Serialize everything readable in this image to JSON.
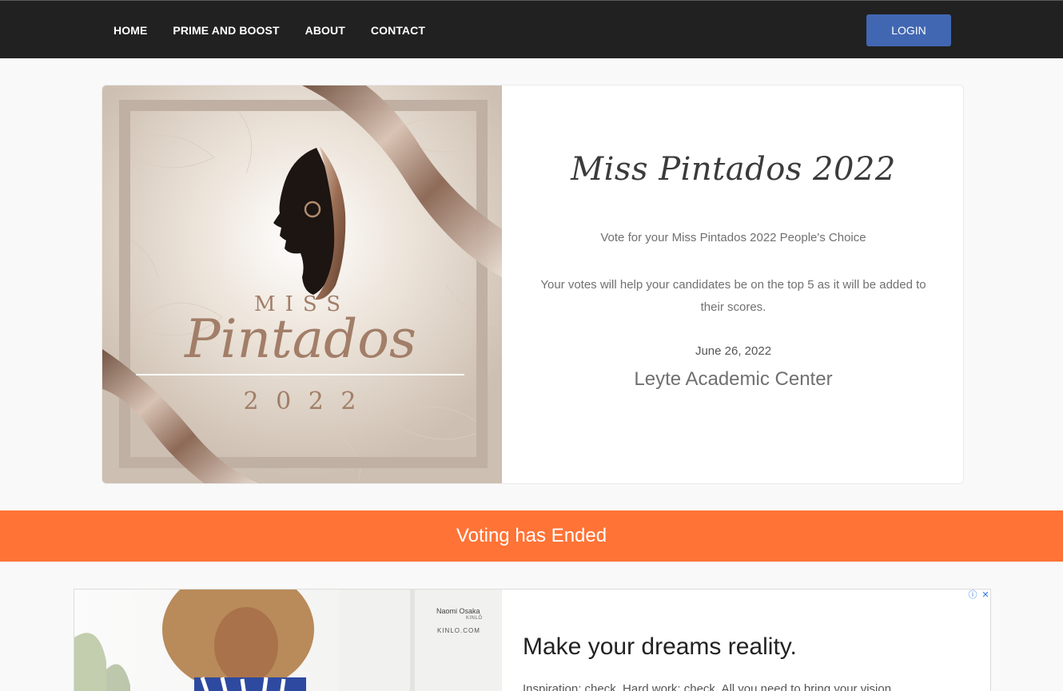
{
  "nav": {
    "links": [
      "HOME",
      "PRIME AND BOOST",
      "ABOUT",
      "CONTACT"
    ],
    "login_label": "LOGIN"
  },
  "event": {
    "poster": {
      "word_miss": "MISS",
      "word_name": "Pintados",
      "year": "2 0 2 2"
    },
    "title": "Miss Pintados 2022",
    "subtitle": "Vote for your Miss Pintados 2022 People's Choice",
    "description": "Your votes will help your candidates be on the top 5 as it will be added to their scores.",
    "date": "June 26, 2022",
    "venue": "Leyte Academic Center"
  },
  "banner": {
    "text": "Voting has Ended"
  },
  "ad": {
    "brand_name": "Naomi Osaka",
    "brand_sub": "KINLŌ",
    "brand_url": "KINLO.COM",
    "headline": "Make your dreams reality.",
    "copy": "Inspiration: check. Hard work: check. All you need to bring your vision",
    "info_icon": "ⓘ",
    "close_icon": "✕"
  },
  "colors": {
    "nav_bg": "#212121",
    "login_bg": "#4267b2",
    "banner_bg": "#ff7336",
    "poster_gold": "#a27e68"
  }
}
